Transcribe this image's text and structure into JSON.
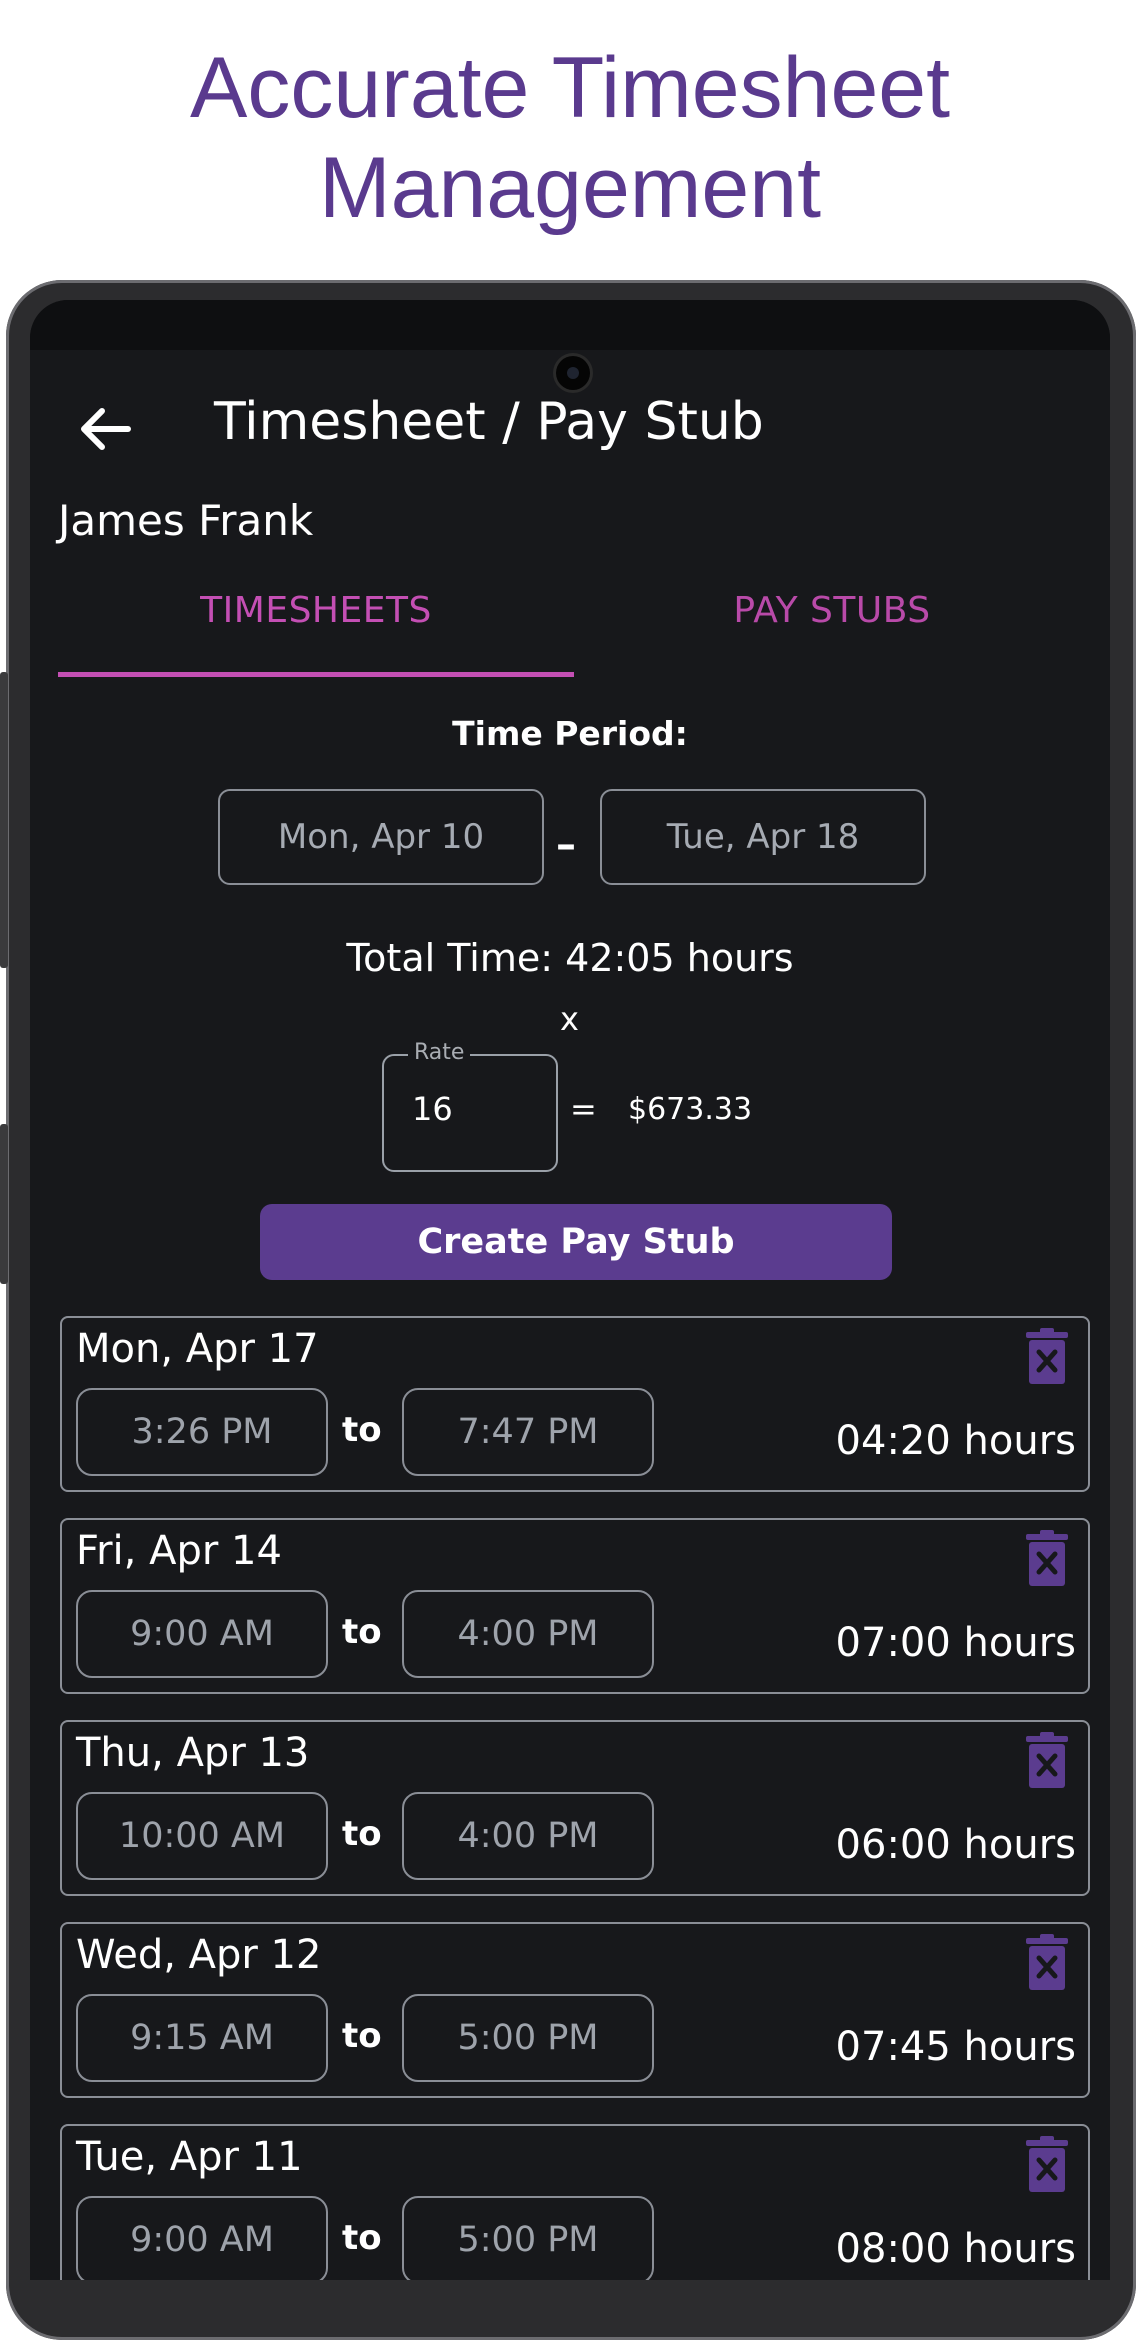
{
  "headline": {
    "line1": "Accurate Timesheet",
    "line2": "Management"
  },
  "colors": {
    "headline": "#5a3a8e",
    "accent_pink": "#c44fb4",
    "button_purple": "#5b3c8f",
    "screen_bg": "#17181b"
  },
  "topbar": {
    "back_icon": "arrow-left-icon",
    "title": "Timesheet / Pay Stub"
  },
  "employee_name": "James Frank",
  "tabs": [
    {
      "label": "TIMESHEETS",
      "selected": true
    },
    {
      "label": "PAY STUBS",
      "selected": false
    }
  ],
  "period": {
    "label": "Time Period:",
    "start": "Mon, Apr 10",
    "separator": "–",
    "end": "Tue, Apr 18"
  },
  "summary": {
    "total_label": "Total Time:",
    "total_value": "42:05 hours",
    "multiply": "x",
    "rate_label": "Rate",
    "rate_value": "16",
    "equals": "=",
    "amount": "$673.33"
  },
  "create_button": "Create Pay Stub",
  "entries": [
    {
      "date": "Mon, Apr 17",
      "start": "3:26 PM",
      "to": "to",
      "end": "7:47 PM",
      "hours": "04:20 hours"
    },
    {
      "date": "Fri, Apr 14",
      "start": "9:00 AM",
      "to": "to",
      "end": "4:00 PM",
      "hours": "07:00 hours"
    },
    {
      "date": "Thu, Apr 13",
      "start": "10:00 AM",
      "to": "to",
      "end": "4:00 PM",
      "hours": "06:00 hours"
    },
    {
      "date": "Wed, Apr 12",
      "start": "9:15 AM",
      "to": "to",
      "end": "5:00 PM",
      "hours": "07:45 hours"
    },
    {
      "date": "Tue, Apr 11",
      "start": "9:00 AM",
      "to": "to",
      "end": "5:00 PM",
      "hours": "08:00 hours"
    }
  ],
  "entry_delete_icon": "trash-icon"
}
